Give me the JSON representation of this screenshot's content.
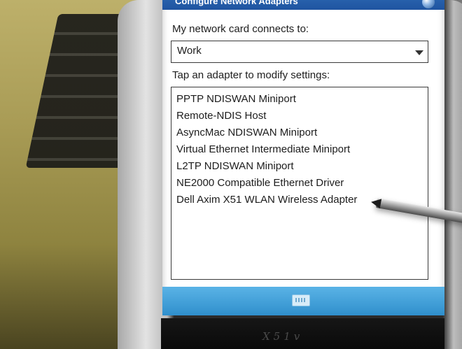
{
  "window": {
    "title": "Configure Network Adapters"
  },
  "connection": {
    "label": "My network card connects to:",
    "selected": "Work"
  },
  "adapters": {
    "label": "Tap an adapter to modify settings:",
    "items": [
      {
        "label": "PPTP NDISWAN Miniport"
      },
      {
        "label": "Remote-NDIS Host"
      },
      {
        "label": "AsyncMac NDISWAN Miniport"
      },
      {
        "label": "Virtual Ethernet Intermediate Miniport"
      },
      {
        "label": "L2TP NDISWAN Miniport"
      },
      {
        "label": "NE2000 Compatible Ethernet Driver"
      },
      {
        "label": "Dell Axim X51 WLAN Wireless Adapter"
      }
    ]
  },
  "device": {
    "brand": "X51v"
  },
  "icons": {
    "title": "help-icon",
    "dropdown": "chevron-down-icon",
    "menu": "keyboard-icon"
  },
  "colors": {
    "title_bar": "#1f54a0",
    "menu_bar": "#2f8fcc",
    "screen_bg": "#ffffff",
    "text": "#1d1d1d"
  }
}
